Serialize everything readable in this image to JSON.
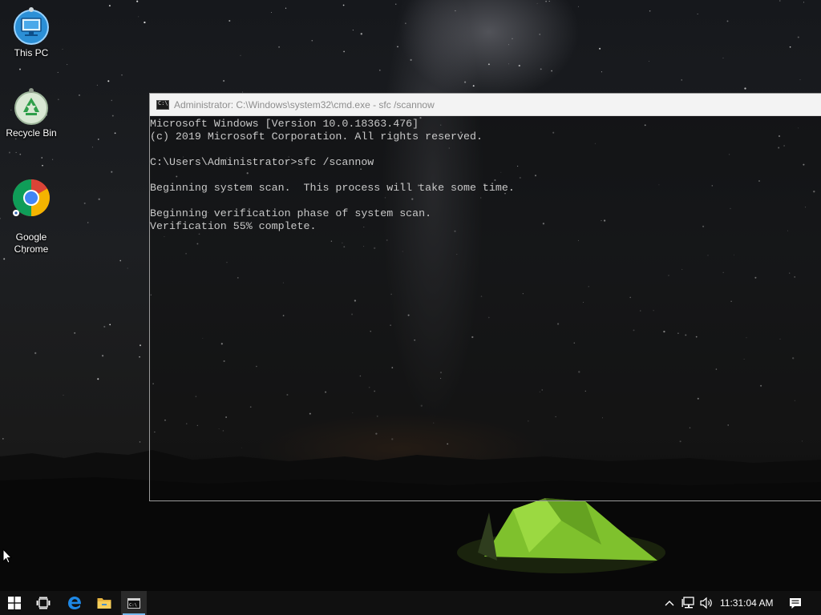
{
  "desktop": {
    "icons": [
      {
        "label": "This PC",
        "icon": "this-pc-icon"
      },
      {
        "label": "Recycle Bin",
        "icon": "recycle-bin-icon"
      },
      {
        "label": "Google\nChrome",
        "icon": "chrome-icon"
      }
    ]
  },
  "cmd": {
    "title": "Administrator: C:\\Windows\\system32\\cmd.exe - sfc  /scannow",
    "lines": [
      "Microsoft Windows [Version 10.0.18363.476]",
      "(c) 2019 Microsoft Corporation. All rights reserved.",
      "",
      "C:\\Users\\Administrator>sfc /scannow",
      "",
      "Beginning system scan.  This process will take some time.",
      "",
      "Beginning verification phase of system scan.",
      "Verification 55% complete."
    ]
  },
  "taskbar": {
    "buttons": [
      {
        "name": "start-button",
        "icon": "windows-logo-icon"
      },
      {
        "name": "task-view-button",
        "icon": "task-view-icon"
      },
      {
        "name": "edge-button",
        "icon": "edge-icon"
      },
      {
        "name": "file-explorer-button",
        "icon": "folder-icon"
      },
      {
        "name": "cmd-taskbar-button",
        "icon": "cmd-icon",
        "active": true
      }
    ],
    "tray": {
      "icons": [
        "chevron-up-icon",
        "network-icon",
        "speaker-icon",
        "action-center-icon"
      ],
      "clock": "11:31:04 AM"
    }
  },
  "colors": {
    "accent": "#76b9ed",
    "console_text": "#c8c8c8",
    "taskbar": "#101010"
  }
}
